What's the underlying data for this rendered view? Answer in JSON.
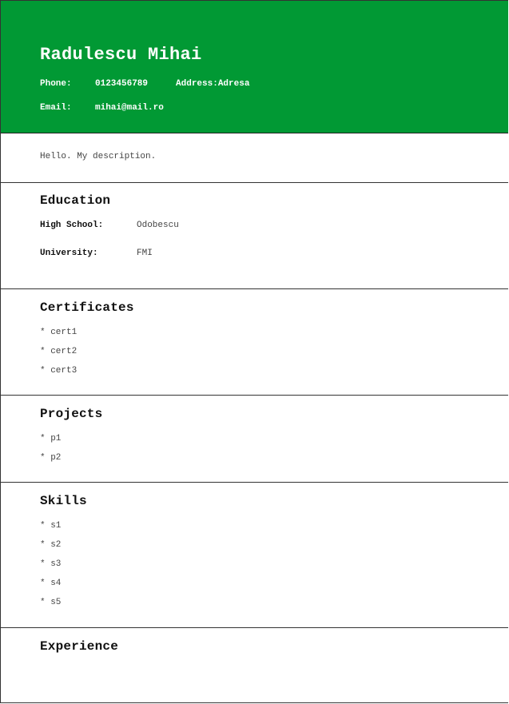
{
  "header": {
    "name": "Radulescu Mihai",
    "phone_label": "Phone:",
    "phone": "0123456789",
    "address_label": "Address:",
    "address": "Adresa",
    "email_label": "Email:",
    "email": "mihai@mail.ro"
  },
  "description": "Hello. My description.",
  "education": {
    "title": "Education",
    "high_school_label": "High School:",
    "high_school": "Odobescu",
    "university_label": "University:",
    "university": "FMI"
  },
  "certificates": {
    "title": "Certificates",
    "items": [
      "* cert1",
      "* cert2",
      "* cert3"
    ]
  },
  "projects": {
    "title": "Projects",
    "items": [
      "* p1",
      "* p2"
    ]
  },
  "skills": {
    "title": "Skills",
    "items": [
      "* s1",
      "* s2",
      "* s3",
      "* s4",
      "* s5"
    ]
  },
  "experience": {
    "title": "Experience"
  },
  "colors": {
    "header_bg": "#019934",
    "header_text": "#ffffff"
  }
}
